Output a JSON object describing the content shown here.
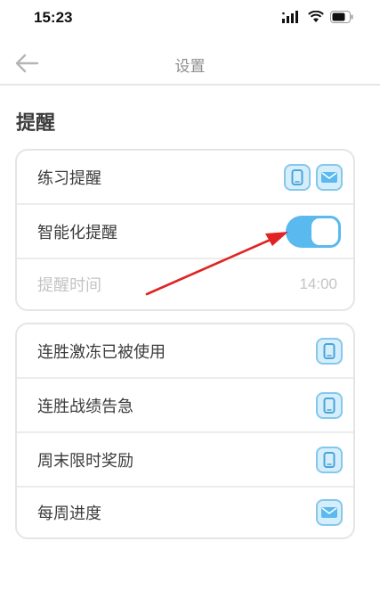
{
  "status_bar": {
    "time": "15:23"
  },
  "nav": {
    "title": "设置"
  },
  "section": {
    "title": "提醒"
  },
  "card1": {
    "rows": [
      {
        "label": "练习提醒"
      },
      {
        "label": "智能化提醒",
        "toggle_on": true
      },
      {
        "label": "提醒时间",
        "value": "14:00"
      }
    ]
  },
  "card2": {
    "rows": [
      {
        "label": "连胜激冻已被使用",
        "icon": "phone-icon"
      },
      {
        "label": "连胜战绩告急",
        "icon": "phone-icon"
      },
      {
        "label": "周末限时奖励",
        "icon": "phone-icon"
      },
      {
        "label": "每周进度",
        "icon": "mail-icon"
      }
    ]
  },
  "colors": {
    "accent": "#5ab9ee",
    "icon_bg": "#d6eefb",
    "annotation_arrow": "#e02424"
  }
}
